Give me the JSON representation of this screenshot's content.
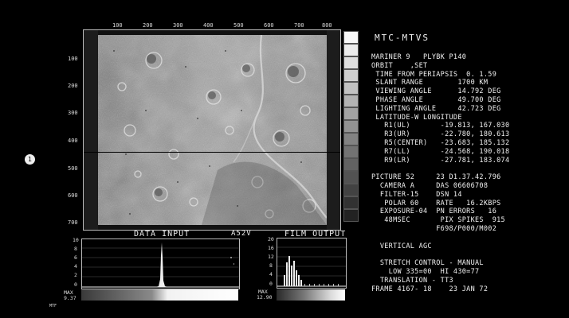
{
  "image_axis": {
    "x_ticks": [
      "100",
      "200",
      "300",
      "400",
      "500",
      "600",
      "700",
      "800"
    ],
    "y_ticks": [
      "100",
      "200",
      "300",
      "400",
      "500",
      "600",
      "700"
    ]
  },
  "marker_label": "1",
  "header": {
    "title": "MTC-MTVS"
  },
  "info_lines": [
    "MARINER 9   PLYBK P140",
    "ORBIT    ,SET",
    " TIME FROM PERIAPSIS  0. 1.59",
    " SLANT RANGE        1700 KM",
    " VIEWING ANGLE      14.792 DEG",
    " PHASE ANGLE        49.700 DEG",
    " LIGHTING ANGLE     42.723 DEG",
    " LATITUDE-W LONGITUDE",
    "   R1(UL)       -19.813, 167.030",
    "   R3(UR)       -22.780, 180.613",
    "   R5(CENTER)   -23.683, 185.132",
    "   R7(LL)       -24.568, 190.018",
    "   R9(LR)       -27.781, 183.074",
    "",
    "PICTURE 52     23 D1.37.42.796",
    "  CAMERA A     DAS 06606708",
    "  FILTER-15    DSN 14",
    "   POLAR 60    RATE   16.2KBPS",
    "  EXPOSURE-04  PN ERRORS   16",
    "   48MSEC       PIX SPIKES  915",
    "               F698/P000/M002",
    "",
    "  VERTICAL AGC",
    "",
    "  STRETCH CONTROL - MANUAL",
    "    LOW 335=00  HI 430=77",
    "  TRANSLATION - TT3",
    "FRAME 4167- 18    23 JAN 72"
  ],
  "data_input": {
    "title": "DATA INPUT",
    "tag": "A52V",
    "y_ticks": [
      "10",
      "8",
      "6",
      "4",
      "2",
      "0"
    ],
    "max_label": "MAX",
    "max_value": "9.37",
    "corner_label": "MTF"
  },
  "film_output": {
    "title": "FILM OUTPUT",
    "y_ticks": [
      "20",
      "16",
      "12",
      "8",
      "4",
      "0"
    ],
    "max_label": "MAX",
    "max_value": "12.90"
  }
}
